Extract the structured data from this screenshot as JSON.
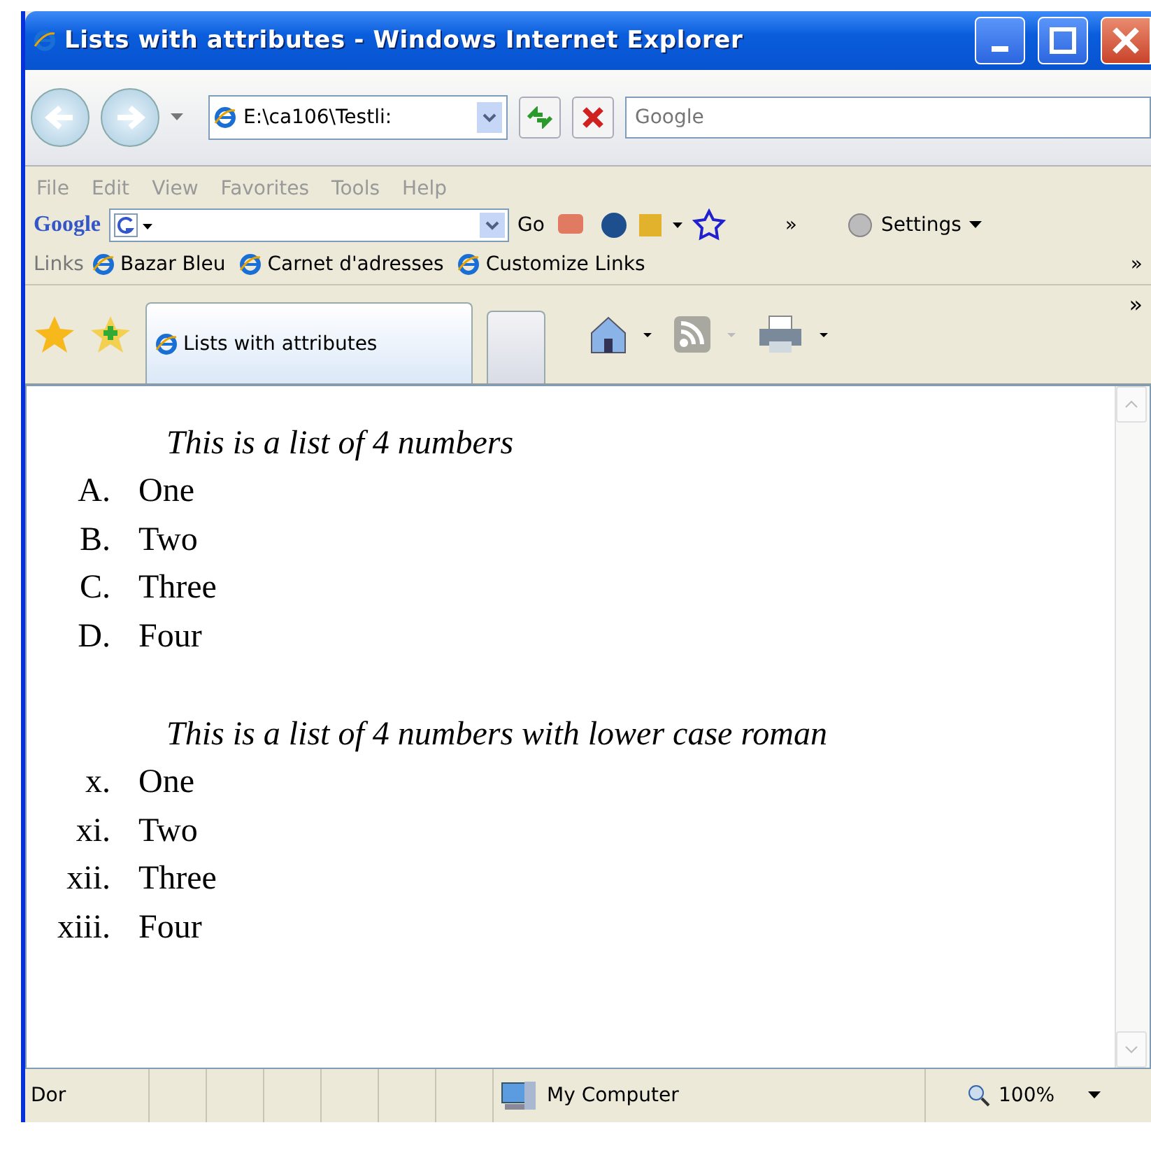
{
  "window": {
    "title": "Lists with attributes - Windows Internet Explorer"
  },
  "address": {
    "value": "E:\\ca106\\Testli:"
  },
  "search": {
    "placeholder": "Google"
  },
  "menu": [
    "File",
    "Edit",
    "View",
    "Favorites",
    "Tools",
    "Help"
  ],
  "google_bar": {
    "logo": "Google",
    "go": "Go",
    "more": "»",
    "settings": "Settings"
  },
  "links_bar": {
    "label": "Links",
    "items": [
      "Bazar Bleu",
      "Carnet d'adresses",
      "Customize Links"
    ],
    "more": "»"
  },
  "tabs": [
    {
      "label": "Lists with attributes",
      "selected": true
    }
  ],
  "tab_bar_more": "»",
  "lists": [
    {
      "caption": "This is a list of 4 numbers",
      "items": [
        {
          "marker": "A.",
          "text": "One"
        },
        {
          "marker": "B.",
          "text": "Two"
        },
        {
          "marker": "C.",
          "text": "Three"
        },
        {
          "marker": "D.",
          "text": "Four"
        }
      ]
    },
    {
      "caption": "This is a list of 4 numbers with lower case roman",
      "items": [
        {
          "marker": "x.",
          "text": "One"
        },
        {
          "marker": "xi.",
          "text": "Two"
        },
        {
          "marker": "xii.",
          "text": "Three"
        },
        {
          "marker": "xiii.",
          "text": "Four"
        }
      ]
    }
  ],
  "status_bar": {
    "status": "Dor",
    "zone": "My Computer",
    "zoom": "100%"
  }
}
